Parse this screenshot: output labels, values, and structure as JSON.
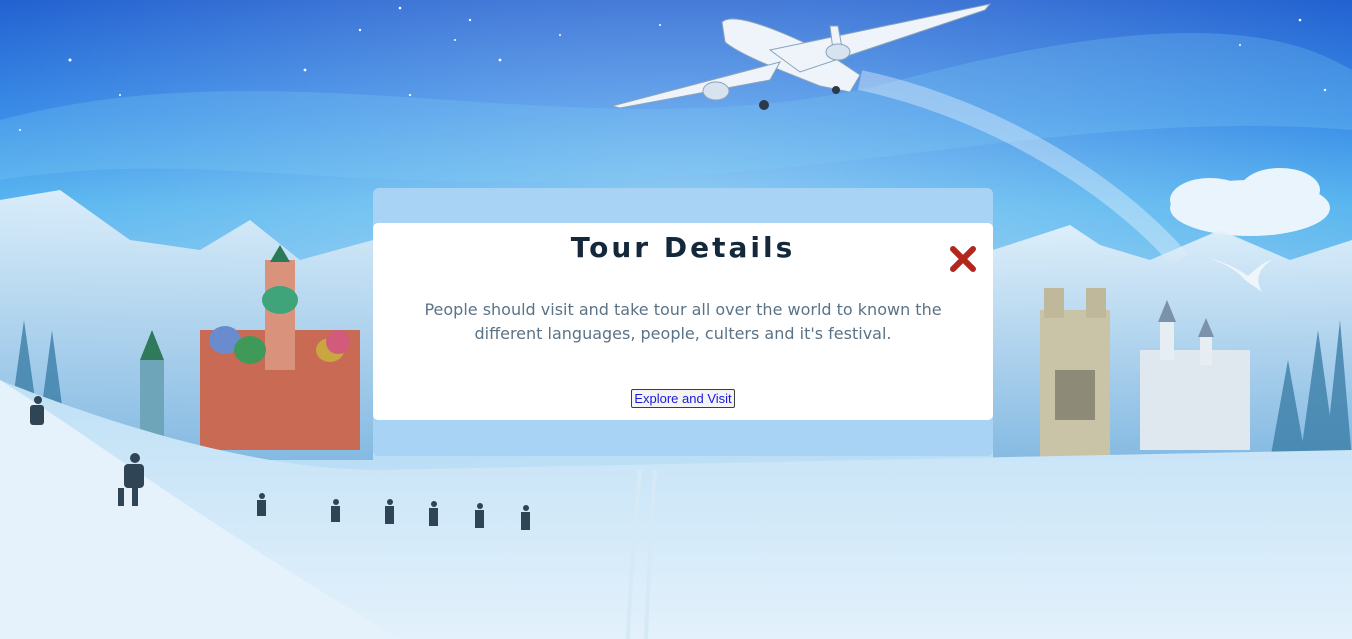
{
  "modal": {
    "title": "Tour Details",
    "description": "People should visit and take tour all over the world to known the different languages, people, culters and it's festival.",
    "button_label": "Explore and Visit",
    "close_icon": "close-icon"
  },
  "colors": {
    "title": "#13283a",
    "description": "#5b7386",
    "close": "#b3261e",
    "modal_frame": "#a8d3f4",
    "button_text": "#1a1adb"
  }
}
